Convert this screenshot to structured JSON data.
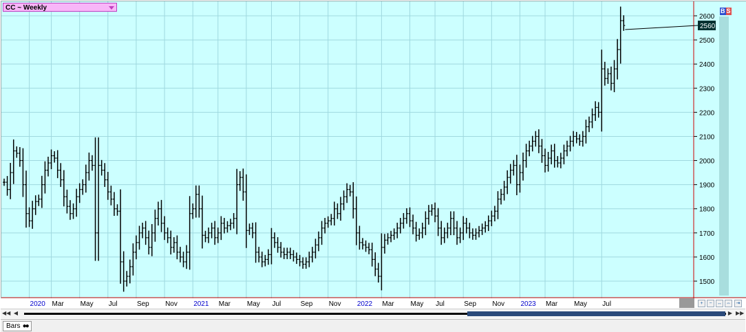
{
  "symbol": {
    "label": "CC ~ Weekly"
  },
  "indicators": {
    "b": "B",
    "s": "S"
  },
  "status": {
    "tab_label": "Bars"
  },
  "colors": {
    "background": "#ccffff",
    "bars": "#000000",
    "last_price_tag": "#003030",
    "price_line": "#cc0000",
    "year_label": "#0000cc"
  },
  "chart_data": {
    "type": "ohlc",
    "title": "CC ~ Weekly",
    "last_price": 2560,
    "ylim": [
      1440,
      2650
    ],
    "yticks": [
      1500,
      1600,
      1700,
      1800,
      1900,
      2000,
      2100,
      2200,
      2300,
      2400,
      2500,
      2600
    ],
    "grid": true,
    "xticks": [
      {
        "label": "2020",
        "week": 8,
        "year": true
      },
      {
        "label": "Mar",
        "week": 15
      },
      {
        "label": "May",
        "week": 24
      },
      {
        "label": "Jul",
        "week": 33
      },
      {
        "label": "Sep",
        "week": 42
      },
      {
        "label": "Nov",
        "week": 51
      },
      {
        "label": "2021",
        "week": 60,
        "year": true
      },
      {
        "label": "Mar",
        "week": 68
      },
      {
        "label": "May",
        "week": 77
      },
      {
        "label": "Jul",
        "week": 85
      },
      {
        "label": "Sep",
        "week": 94
      },
      {
        "label": "Nov",
        "week": 103
      },
      {
        "label": "2022",
        "week": 112,
        "year": true
      },
      {
        "label": "Mar",
        "week": 120
      },
      {
        "label": "May",
        "week": 129
      },
      {
        "label": "Jul",
        "week": 137
      },
      {
        "label": "Sep",
        "week": 146
      },
      {
        "label": "Nov",
        "week": 155
      },
      {
        "label": "2023",
        "week": 164,
        "year": true
      },
      {
        "label": "Mar",
        "week": 172
      },
      {
        "label": "May",
        "week": 181
      },
      {
        "label": "Jul",
        "week": 190
      }
    ],
    "closes": [
      1910,
      1880,
      1950,
      2040,
      2030,
      2000,
      1900,
      1780,
      1750,
      1800,
      1830,
      1840,
      1900,
      1960,
      1990,
      2020,
      2010,
      1960,
      1920,
      1850,
      1810,
      1780,
      1800,
      1850,
      1880,
      1900,
      1950,
      2000,
      1980,
      1700,
      1980,
      1960,
      1920,
      1870,
      1840,
      1800,
      1790,
      1580,
      1500,
      1520,
      1560,
      1620,
      1660,
      1700,
      1720,
      1680,
      1640,
      1700,
      1760,
      1800,
      1740,
      1700,
      1680,
      1640,
      1660,
      1620,
      1600,
      1580,
      1620,
      1780,
      1800,
      1860,
      1800,
      1690,
      1680,
      1700,
      1720,
      1680,
      1700,
      1740,
      1720,
      1730,
      1740,
      1760,
      1900,
      1930,
      1870,
      1710,
      1720,
      1700,
      1620,
      1600,
      1580,
      1590,
      1610,
      1680,
      1660,
      1640,
      1620,
      1610,
      1620,
      1610,
      1600,
      1590,
      1580,
      1570,
      1580,
      1600,
      1620,
      1650,
      1680,
      1720,
      1740,
      1750,
      1760,
      1800,
      1780,
      1820,
      1850,
      1880,
      1870,
      1800,
      1700,
      1660,
      1650,
      1640,
      1630,
      1590,
      1550,
      1520,
      1640,
      1670,
      1680,
      1690,
      1700,
      1720,
      1740,
      1760,
      1780,
      1750,
      1720,
      1690,
      1700,
      1720,
      1760,
      1790,
      1800,
      1770,
      1720,
      1680,
      1700,
      1720,
      1760,
      1720,
      1680,
      1700,
      1740,
      1720,
      1700,
      1690,
      1700,
      1710,
      1720,
      1730,
      1750,
      1770,
      1790,
      1840,
      1860,
      1890,
      1930,
      1960,
      1980,
      1900,
      1950,
      2000,
      2040,
      2060,
      2080,
      2100,
      2060,
      2020,
      1980,
      2010,
      2040,
      2000,
      1990,
      2010,
      2040,
      2060,
      2080,
      2100,
      2090,
      2080,
      2100,
      2140,
      2160,
      2190,
      2220,
      2200,
      2380,
      2340,
      2360,
      2320,
      2380,
      2460,
      2580,
      2560
    ]
  }
}
